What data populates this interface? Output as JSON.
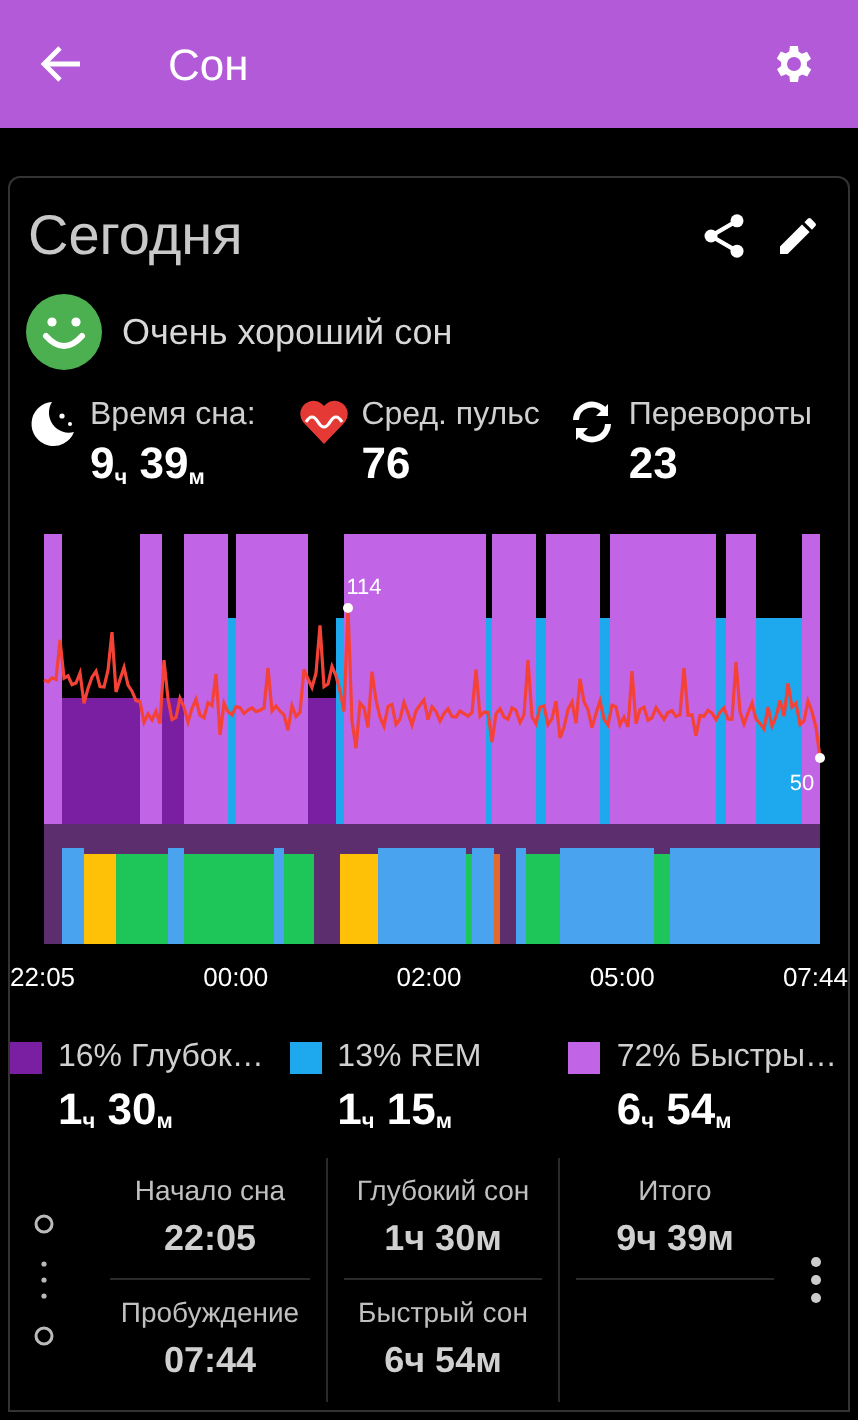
{
  "app_bar": {
    "title": "Сон"
  },
  "card": {
    "title": "Сегодня",
    "quality": "Очень хороший сон"
  },
  "stats": [
    {
      "kind": "moon",
      "label": "Время сна:",
      "value": "9$_{ч}$ 39$_{м}$"
    },
    {
      "kind": "heart",
      "label": "Сред. пульс",
      "value": "76"
    },
    {
      "kind": "turns",
      "label": "Перевороты",
      "value": "23"
    }
  ],
  "chart": {
    "max_label": "114",
    "min_label": "50",
    "times": [
      "22:05",
      "00:00",
      "02:00",
      "05:00",
      "07:44"
    ]
  },
  "legend": [
    {
      "color": "#7b1fa2",
      "label": "16% Глубок…",
      "value": "1$_{ч}$ 30$_{м}$"
    },
    {
      "color": "#1ea8ee",
      "label": "13% REM",
      "value": "1$_{ч}$ 15$_{м}$"
    },
    {
      "color": "#c264e6",
      "label": "72% Быстры…",
      "value": "6$_{ч}$ 54$_{м}$"
    }
  ],
  "summary": [
    [
      {
        "label": "Начало сна",
        "value": "22:05"
      },
      {
        "label": "Пробуждение",
        "value": "07:44"
      }
    ],
    [
      {
        "label": "Глубокий сон",
        "value": "1ч 30м"
      },
      {
        "label": "Быстрый сон",
        "value": "6ч 54м"
      }
    ],
    [
      {
        "label": "Итого",
        "value": "9ч 39м"
      }
    ]
  ]
}
